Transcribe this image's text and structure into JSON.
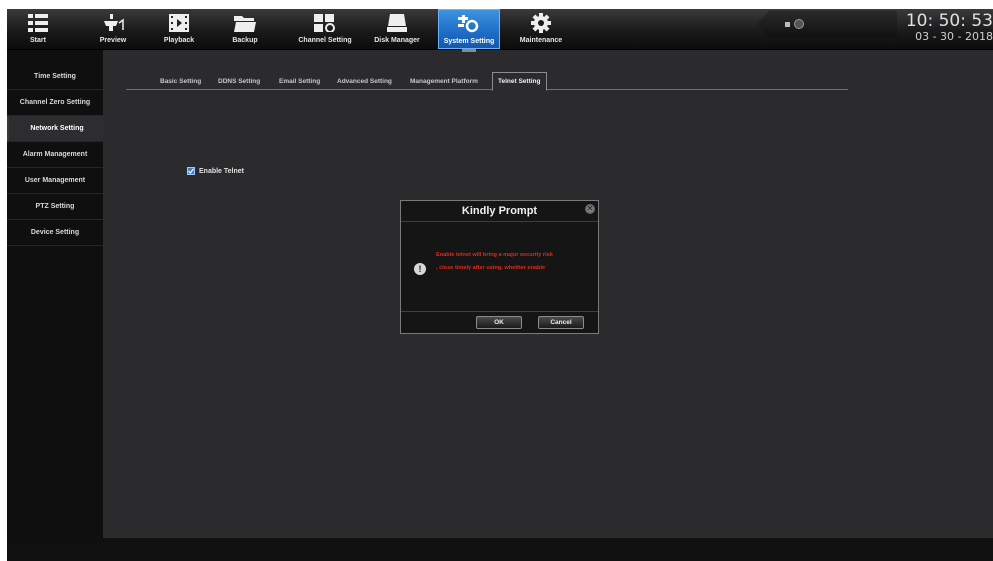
{
  "topbar": {
    "nav": [
      {
        "label": "Start",
        "icon": "menu-grid-icon"
      },
      {
        "label": "Preview",
        "icon": "camera-icon"
      },
      {
        "label": "Playback",
        "icon": "film-icon"
      },
      {
        "label": "Backup",
        "icon": "folder-icon"
      },
      {
        "label": "Channel Setting",
        "icon": "channel-setting-icon"
      },
      {
        "label": "Disk Manager",
        "icon": "disk-icon"
      },
      {
        "label": "System Setting",
        "icon": "system-setting-icon",
        "active": true
      },
      {
        "label": "Maintenance",
        "icon": "gear-icon"
      }
    ],
    "clock": {
      "time": "10: 50: 53",
      "date": "03 - 30 - 2018"
    }
  },
  "sidebar": {
    "items": [
      {
        "label": "Time Setting"
      },
      {
        "label": "Channel Zero Setting"
      },
      {
        "label": "Network Setting",
        "active": true
      },
      {
        "label": "Alarm Management"
      },
      {
        "label": "User Management"
      },
      {
        "label": "PTZ Setting"
      },
      {
        "label": "Device Setting"
      }
    ]
  },
  "tabs": [
    {
      "label": "Basic Setting"
    },
    {
      "label": "DDNS Setting"
    },
    {
      "label": "Email Setting"
    },
    {
      "label": "Advanced Setting"
    },
    {
      "label": "Management Platform"
    },
    {
      "label": "Telnet Setting",
      "active": true
    }
  ],
  "telnet": {
    "label": "Enable Telnet",
    "checked": true
  },
  "dialog": {
    "title": "Kindly Prompt",
    "message_line1": "Enable telnet will bring a major security risk",
    "message_line2": ", close timely after using, whether enable",
    "ok_label": "OK",
    "cancel_label": "Cancel"
  },
  "colors": {
    "accent": "#1d6cc6",
    "warning_text": "#e32a1a",
    "background": "#2b2b2d"
  }
}
